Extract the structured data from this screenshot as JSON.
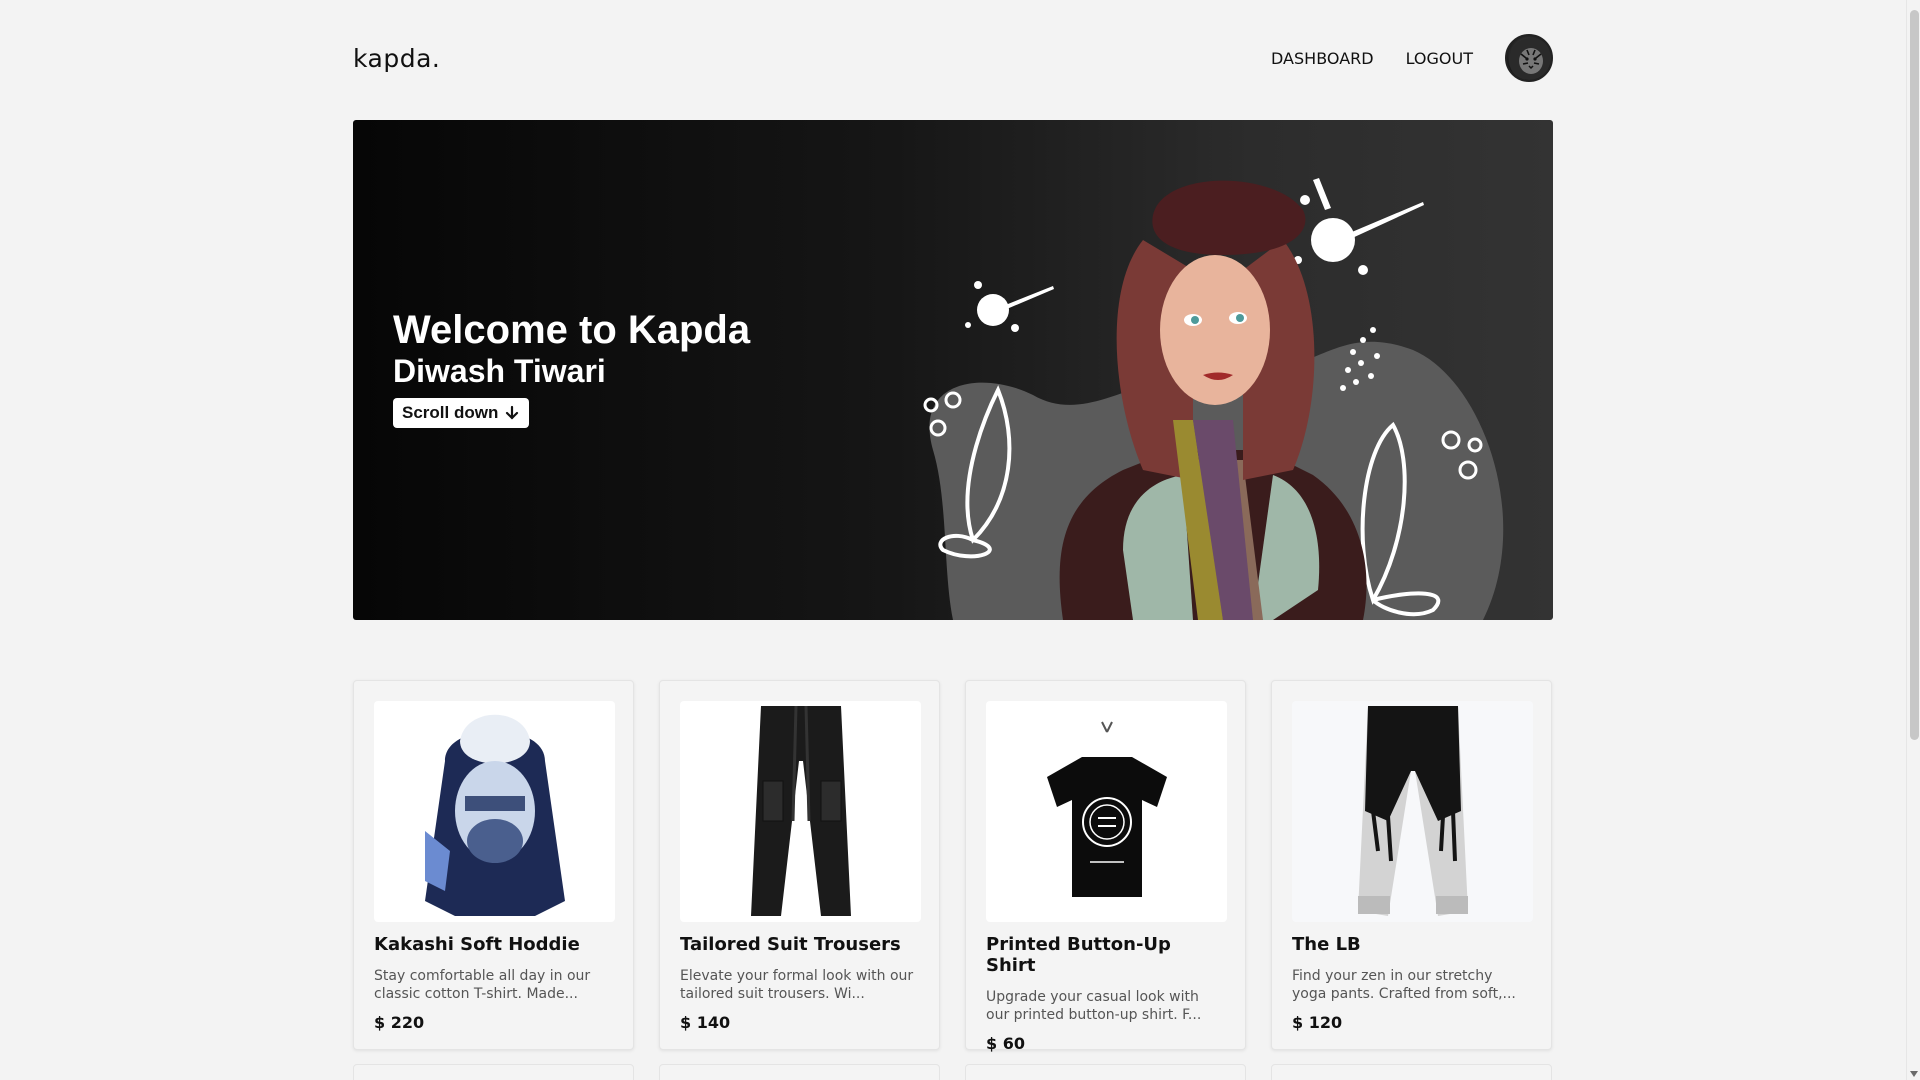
{
  "header": {
    "logo": "kapda.",
    "nav": [
      {
        "label": "DASHBOARD"
      },
      {
        "label": "LOGOUT"
      }
    ],
    "avatar_icon": "tiger-avatar-icon"
  },
  "hero": {
    "title": "Welcome to Kapda",
    "subtitle": "Diwash Tiwari",
    "scroll_label": "Scroll down",
    "scroll_icon": "arrow-down-icon"
  },
  "products": [
    {
      "title": "Kakashi Soft Hoddie",
      "description": "Stay comfortable all day in our classic cotton T-shirt. Made...",
      "price": "$ 220"
    },
    {
      "title": "Tailored Suit Trousers",
      "description": "Elevate your formal look with our tailored suit trousers. Wi...",
      "price": "$ 140"
    },
    {
      "title": "Printed Button-Up Shirt",
      "description": "Upgrade your casual look with our printed button-up shirt. F...",
      "price": "$ 60"
    },
    {
      "title": "The LB",
      "description": "Find your zen in our stretchy yoga pants. Crafted from soft,...",
      "price": "$ 120"
    }
  ],
  "colors": {
    "background": "#f3f3f3",
    "hero_dark": "#060606",
    "hero_light": "#333333",
    "text": "#111111"
  }
}
